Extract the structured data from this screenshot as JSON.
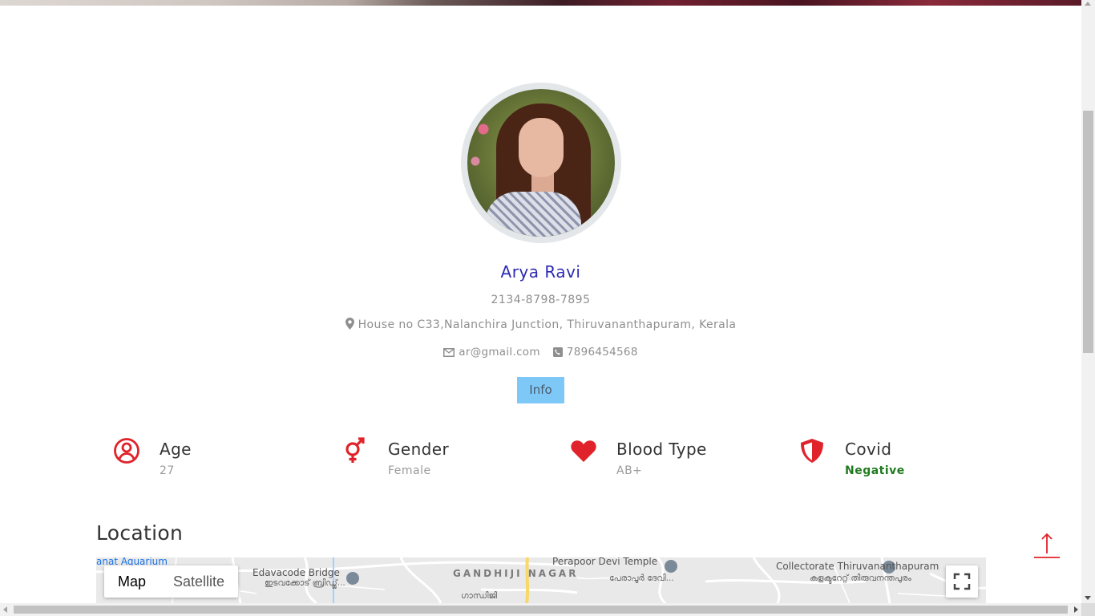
{
  "profile": {
    "name": "Arya Ravi",
    "id_number": "2134-8798-7895",
    "address": "House no C33,Nalanchira Junction, Thiruvananthapuram, Kerala",
    "email": "ar@gmail.com",
    "phone": "7896454568",
    "info_button": "Info"
  },
  "stats": [
    {
      "label": "Age",
      "value": "27",
      "icon": "user-circle-icon"
    },
    {
      "label": "Gender",
      "value": "Female",
      "icon": "gender-icon"
    },
    {
      "label": "Blood Type",
      "value": "AB+",
      "icon": "heart-icon"
    },
    {
      "label": "Covid",
      "value": "Negative",
      "icon": "shield-icon"
    }
  ],
  "location": {
    "title": "Location",
    "map_type_options": [
      "Map",
      "Satellite"
    ],
    "selected_map_type": "Map",
    "places": {
      "aquarium": "anat Aquarium",
      "bridge": "Edavacode Bridge",
      "bridge_ml": "ഇടവക്കോട് ബ്രിഡ്ജ്...",
      "area": "GANDHIJI NAGAR",
      "area_ml": "ഗാന്ധിജി",
      "temple": "Perapoor Devi Temple",
      "temple_ml": "പേരാപൂർ ദേവി...",
      "collectorate": "Collectorate Thiruvananthapuram",
      "collectorate_ml": "കളക്ടറേറ്റ് തിരുവനന്തപുരം"
    }
  },
  "colors": {
    "name": "#2d2bb3",
    "accent_red": "#e0232b",
    "info_button": "#7ec8f7",
    "negative": "#1f7a1f"
  }
}
